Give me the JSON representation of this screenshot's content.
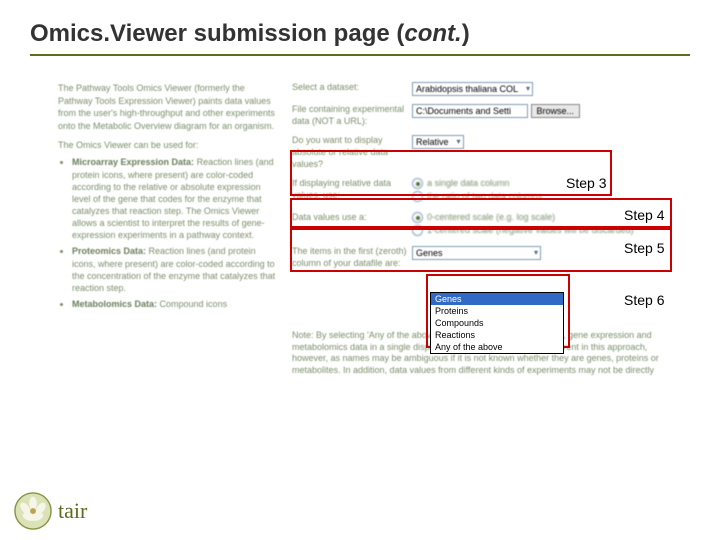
{
  "title": {
    "main": "Omics.Viewer submission page (",
    "cont": "cont.",
    "close": ")"
  },
  "left": {
    "intro": "The Pathway Tools Omics Viewer (formerly the Pathway Tools Expression Viewer) paints data values from the user's high-throughput and other experiments onto the Metabolic Overview diagram for an organism.",
    "subhead": "The Omics Viewer can be used for:",
    "bullet1_bold": "Microarray Expression Data:",
    "bullet1": " Reaction lines (and protein icons, where present) are color-coded according to the relative or absolute expression level of the gene that codes for the enzyme that catalyzes that reaction step. The Omics Viewer allows a scientist to interpret the results of gene-expression experiments in a pathway context.",
    "bullet2_bold": "Proteomics Data:",
    "bullet2": " Reaction lines (and protein icons, where present) are color-coded according to the concentration of the enzyme that catalyzes that reaction step.",
    "bullet3_bold": "Metabolomics Data:",
    "bullet3": " Compound icons"
  },
  "form": {
    "dataset_label": "Select a dataset:",
    "dataset_value": "Arabidopsis thaliana COL",
    "file_label": "File containing experimental data (NOT a URL):",
    "file_value": "C:\\Documents and Setti",
    "browse": "Browse...",
    "absrel_label": "Do you want to display absolute or relative data values?",
    "absrel_value": "Relative",
    "reluse_label": "If displaying relative data values, use:",
    "rel_opt1": "a single data column",
    "rel_opt2": "the ratio of two data columns",
    "scale_label": "Data values use a:",
    "scale_opt1": "0-centered scale (e.g. log scale)",
    "scale_opt2": "1-centered scale (negative values will be discarded)",
    "items_label": "The items in the first (zeroth) column of your datafile are:",
    "items_value": "Genes",
    "dd_opts": [
      "Genes",
      "Proteins",
      "Compounds",
      "Reactions",
      "Any of the above"
    ],
    "note": "Note: By selecting 'Any of the above', you can combine, for example, gene expression and metabolomics data in a single display. There are some dangers inherent in this approach, however, as names may be ambiguous if it is not known whether they are genes, proteins or metabolites. In addition, data values from different kinds of experiments may not be directly"
  },
  "steps": {
    "s3": "Step 3",
    "s4": "Step 4",
    "s5": "Step 5",
    "s6": "Step 6"
  },
  "logo": {
    "text": "tair"
  }
}
